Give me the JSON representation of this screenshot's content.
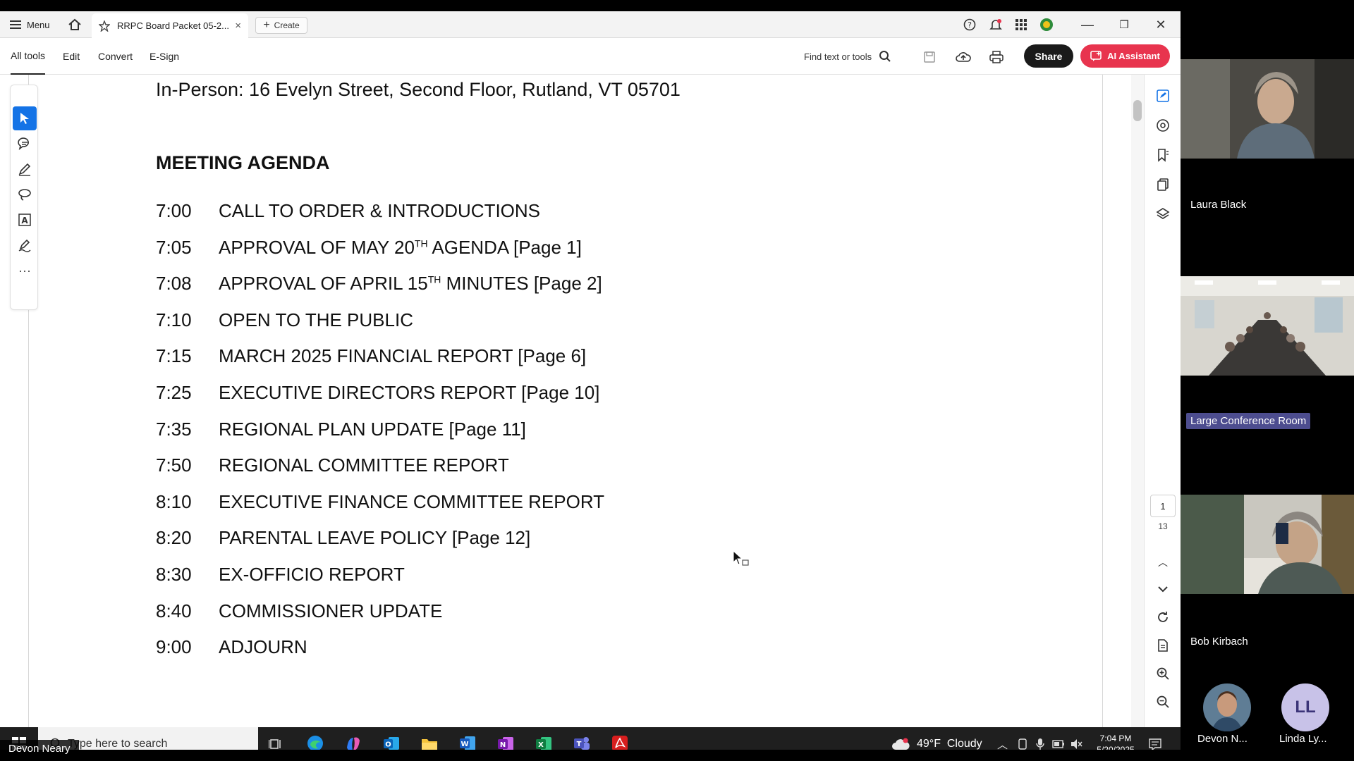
{
  "app": {
    "menu_label": "Menu",
    "tab_title": "RRPC Board Packet 05-2...",
    "create_label": "Create"
  },
  "toolbar": {
    "items": [
      "All tools",
      "Edit",
      "Convert",
      "E-Sign"
    ],
    "find_label": "Find text or tools",
    "share_label": "Share",
    "ai_label": "AI Assistant"
  },
  "document": {
    "address_line": "In-Person: 16 Evelyn Street, Second Floor, Rutland, VT 05701",
    "heading": "MEETING AGENDA",
    "agenda": [
      {
        "time": "7:00",
        "pre": "CALL TO ORDER & INTRODUCTIONS",
        "sup": "",
        "post": ""
      },
      {
        "time": "7:05",
        "pre": "APPROVAL OF MAY 20",
        "sup": "TH",
        "post": " AGENDA [Page 1]"
      },
      {
        "time": "7:08",
        "pre": "APPROVAL OF APRIL 15",
        "sup": "TH",
        "post": " MINUTES [Page 2]"
      },
      {
        "time": "7:10",
        "pre": "OPEN TO THE PUBLIC",
        "sup": "",
        "post": ""
      },
      {
        "time": "7:15",
        "pre": "MARCH 2025 FINANCIAL REPORT [Page 6]",
        "sup": "",
        "post": ""
      },
      {
        "time": "7:25",
        "pre": "EXECUTIVE DIRECTORS REPORT [Page 10]",
        "sup": "",
        "post": ""
      },
      {
        "time": "7:35",
        "pre": "REGIONAL PLAN UPDATE [Page 11]",
        "sup": "",
        "post": ""
      },
      {
        "time": "7:50",
        "pre": "REGIONAL COMMITTEE REPORT",
        "sup": "",
        "post": ""
      },
      {
        "time": "8:10",
        "pre": "EXECUTIVE FINANCE COMMITTEE REPORT",
        "sup": "",
        "post": ""
      },
      {
        "time": "8:20",
        "pre": "PARENTAL LEAVE POLICY [Page 12]",
        "sup": "",
        "post": ""
      },
      {
        "time": "8:30",
        "pre": "EX-OFFICIO REPORT",
        "sup": "",
        "post": ""
      },
      {
        "time": "8:40",
        "pre": "COMMISSIONER UPDATE",
        "sup": "",
        "post": ""
      },
      {
        "time": "9:00",
        "pre": "ADJOURN",
        "sup": "",
        "post": ""
      }
    ]
  },
  "pager": {
    "current": "1",
    "total": "13"
  },
  "taskbar": {
    "search_placeholder": "Type here to search",
    "weather": "49°F  Cloudy",
    "time": "7:04 PM",
    "date": "5/20/2025"
  },
  "meeting": {
    "presenter": "Devon Neary",
    "participants": [
      {
        "name": "Laura Black"
      },
      {
        "name": "Large Conference Room"
      },
      {
        "name": "Bob Kirbach"
      }
    ],
    "small_tiles": [
      {
        "name": "Devon N...",
        "initials": ""
      },
      {
        "name": "Linda Ly...",
        "initials": "LL"
      }
    ]
  },
  "colors": {
    "accent": "#1473e6",
    "ai_button": "#e8344e",
    "share_button": "#1a1a1a",
    "name_badge": "#4d4d8f"
  }
}
